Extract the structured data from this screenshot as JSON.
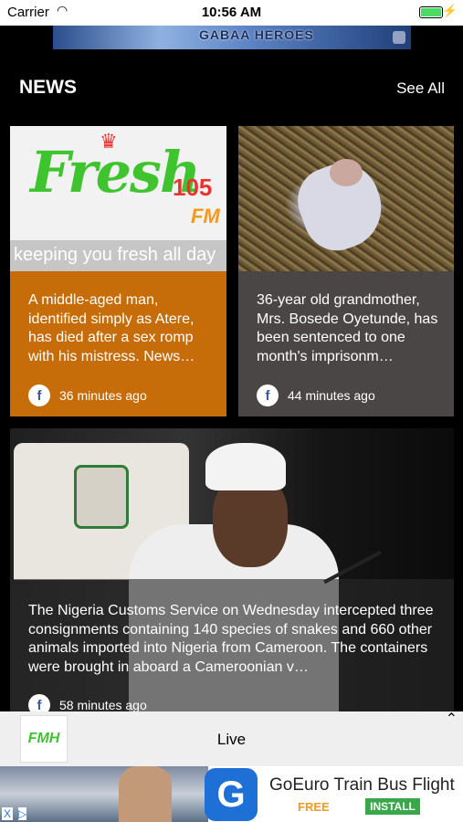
{
  "status_bar": {
    "carrier": "Carrier",
    "time": "10:56 AM",
    "battery_level": 1.0
  },
  "top_ad": {
    "text": "GABAA HEROES"
  },
  "news": {
    "title": "NEWS",
    "see_all_label": "See All"
  },
  "cards": [
    {
      "image_text": {
        "logo": "Fresh",
        "freq": "105",
        "band": "FM",
        "tagline": "keeping you fresh all day"
      },
      "headline": "A middle-aged man, identified simply as Atere, has died after a sex romp with his mistress. News…",
      "source_icon": "f",
      "time_ago": "36 minutes ago",
      "color": "#c66c08"
    },
    {
      "headline": "36-year old grandmother, Mrs. Bosede Oyetunde, has been sentenced to one month's imprisonm…",
      "source_icon": "f",
      "time_ago": "44 minutes ago",
      "color": "#4b4646"
    },
    {
      "headline": "The Nigeria Customs Service on Wednesday intercepted three consignments containing 140 species of snakes and 660 other animals imported into Nigeria from Cameroon. The containers were brought in aboard a Cameroonian v…",
      "source_icon": "f",
      "time_ago": "58 minutes ago"
    }
  ],
  "player": {
    "logo_text": "FMH",
    "status": "Live",
    "collapse_icon": "chevron-up-icon"
  },
  "bottom_ad": {
    "app_icon_letter": "G",
    "app_name": "GoEuro Train Bus Flight",
    "price": "FREE",
    "install_label": "INSTALL",
    "close_label": "X",
    "adchoices_label": "▷"
  }
}
